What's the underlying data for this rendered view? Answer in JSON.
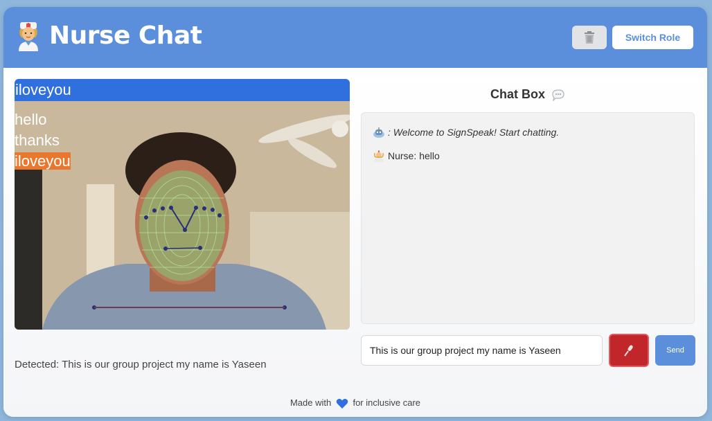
{
  "header": {
    "title": "Nurse Chat",
    "title_icon": "nurse-emoji-icon",
    "trash_icon": "trash-icon",
    "switch_role_label": "Switch Role"
  },
  "video": {
    "top_label": "iloveyou",
    "gestures": [
      "hello",
      "thanks",
      "iloveyou"
    ],
    "active_gesture": "iloveyou",
    "detected_prefix": "Detected:",
    "detected_text": "This is our group project my name is Yaseen"
  },
  "chat": {
    "title": "Chat Box",
    "title_icon": "speech-bubble-icon",
    "messages": [
      {
        "icon": "robot-icon",
        "sender": "",
        "text": ": Welcome to SignSpeak! Start chatting.",
        "style": "system"
      },
      {
        "icon": "nurse-emoji-icon",
        "sender": "Nurse:",
        "text": "hello",
        "style": "user"
      }
    ],
    "input_value": "This is our group project my name is Yaseen",
    "mic_icon": "microphone-icon",
    "send_label": "Send"
  },
  "footer": {
    "prefix": "Made with",
    "heart_icon": "blue-heart-icon",
    "suffix": "for inclusive care"
  },
  "colors": {
    "header_bg": "#5b8fdc",
    "label_bar": "#2f6fde",
    "active_highlight": "#e9782e",
    "mic_button": "#c0262a",
    "send_button": "#5b8fdc"
  }
}
